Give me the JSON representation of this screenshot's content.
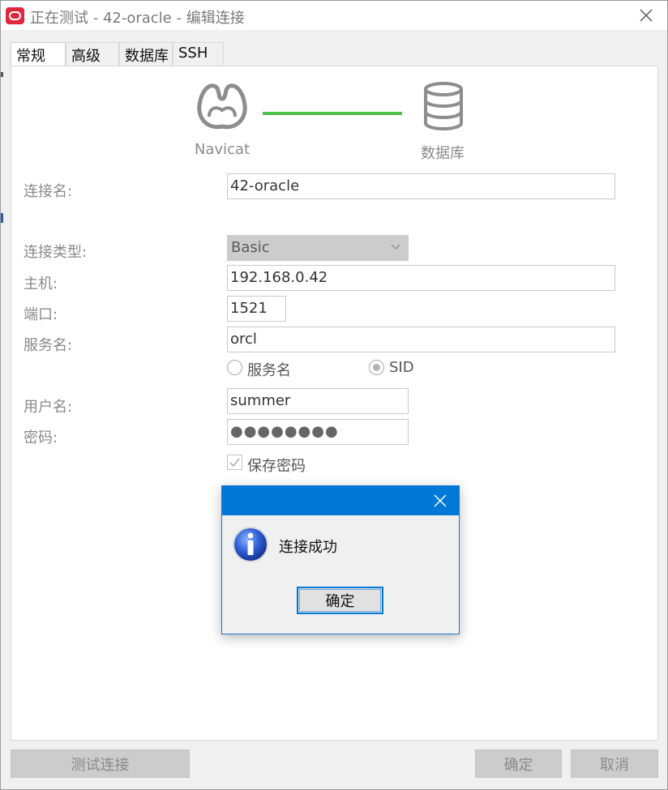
{
  "window": {
    "title": "正在测试 - 42-oracle - 编辑连接"
  },
  "tabs": [
    {
      "label": "常规",
      "active": true
    },
    {
      "label": "高级",
      "active": false
    },
    {
      "label": "数据库",
      "active": false
    },
    {
      "label": "SSH",
      "active": false
    }
  ],
  "header": {
    "left_label": "Navicat",
    "right_label": "数据库",
    "connector_color": "#4cc14c"
  },
  "form": {
    "connection_name": {
      "label": "连接名:",
      "value": "42-oracle"
    },
    "connection_type": {
      "label": "连接类型:",
      "value": "Basic"
    },
    "host": {
      "label": "主机:",
      "value": "192.168.0.42"
    },
    "port": {
      "label": "端口:",
      "value": "1521"
    },
    "service_name": {
      "label": "服务名:",
      "value": "orcl"
    },
    "radio_service_name": {
      "label": "服务名",
      "checked": false
    },
    "radio_sid": {
      "label": "SID",
      "checked": true
    },
    "username": {
      "label": "用户名:",
      "value": "summer"
    },
    "password": {
      "label": "密码:",
      "value": "●●●●●●●●"
    },
    "save_password": {
      "label": "保存密码",
      "checked": true
    }
  },
  "buttons": {
    "test_connection": "测试连接",
    "ok": "确定",
    "cancel": "取消"
  },
  "modal": {
    "message": "连接成功",
    "ok": "确定",
    "titlebar_color": "#0078d7"
  }
}
